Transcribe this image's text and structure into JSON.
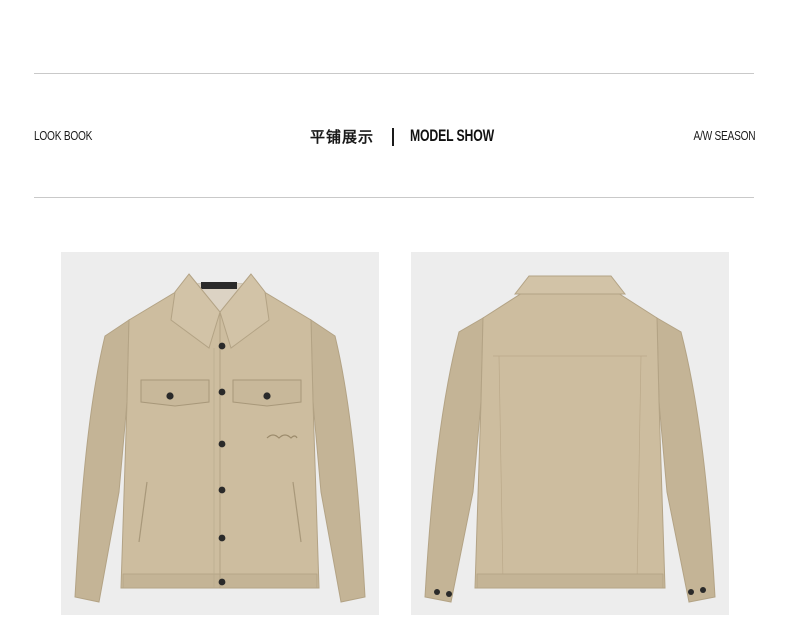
{
  "header": {
    "left_label": "LOOK BOOK",
    "center_cn": "平铺展示",
    "center_en": "MODEL SHOW",
    "right_label": "A/W SEASON"
  },
  "images": [
    {
      "name": "jacket-front",
      "color": "#c9b99b"
    },
    {
      "name": "jacket-back",
      "color": "#cdbd9f"
    }
  ]
}
